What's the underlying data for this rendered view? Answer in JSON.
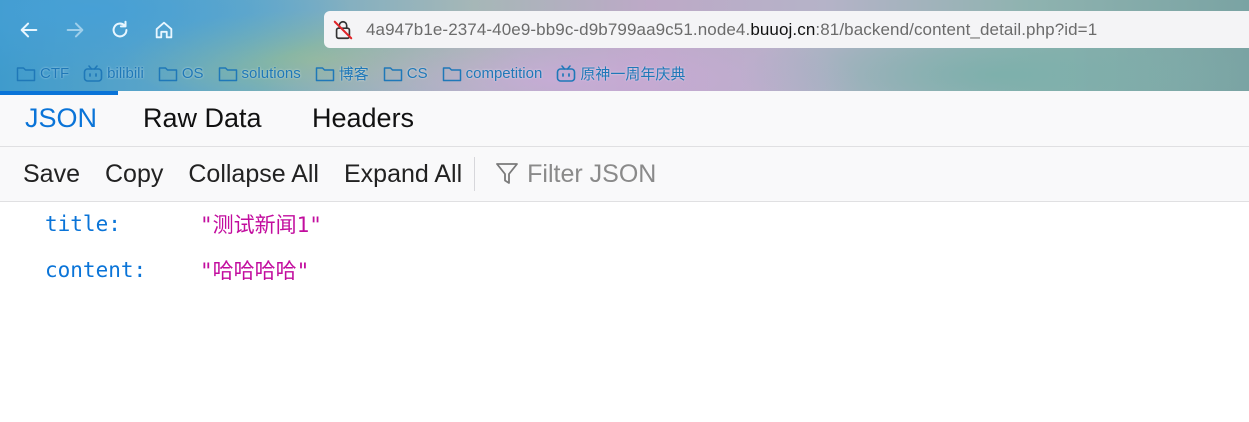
{
  "browser": {
    "url_prefix": "4a947b1e-2374-40e9-bb9c-d9b799aa9c51.node4.",
    "url_host": "buuoj.cn",
    "url_suffix": ":81/backend/content_detail.php?id=1",
    "nav_icons": [
      "back-arrow-icon",
      "forward-arrow-icon",
      "reload-icon",
      "home-icon"
    ],
    "security_icon": "insecure-lock-icon"
  },
  "bookmarks": [
    {
      "label": "CTF",
      "icon": "folder-icon"
    },
    {
      "label": "bilibili",
      "icon": "bilibili-icon"
    },
    {
      "label": "OS",
      "icon": "folder-icon"
    },
    {
      "label": "solutions",
      "icon": "folder-icon"
    },
    {
      "label": "博客",
      "icon": "folder-icon"
    },
    {
      "label": "CS",
      "icon": "folder-icon"
    },
    {
      "label": "competition",
      "icon": "folder-icon"
    },
    {
      "label": "原神一周年庆典",
      "icon": "bilibili-icon"
    }
  ],
  "tabs": [
    {
      "label": "JSON",
      "active": true
    },
    {
      "label": "Raw Data",
      "active": false
    },
    {
      "label": "Headers",
      "active": false
    }
  ],
  "toolbar": {
    "save_label": "Save",
    "copy_label": "Copy",
    "collapse_label": "Collapse All",
    "expand_label": "Expand All",
    "filter_placeholder": "Filter JSON",
    "filter_value": ""
  },
  "json_rows": [
    {
      "key": "title:",
      "value": "\"测试新闻1\""
    },
    {
      "key": "content:",
      "value": "\"哈哈哈哈\""
    }
  ],
  "colors": {
    "accent": "#0a74d8",
    "json_key": "#0a74d8",
    "json_string": "#c20d9e",
    "bookmark_text": "#1f78b8"
  }
}
